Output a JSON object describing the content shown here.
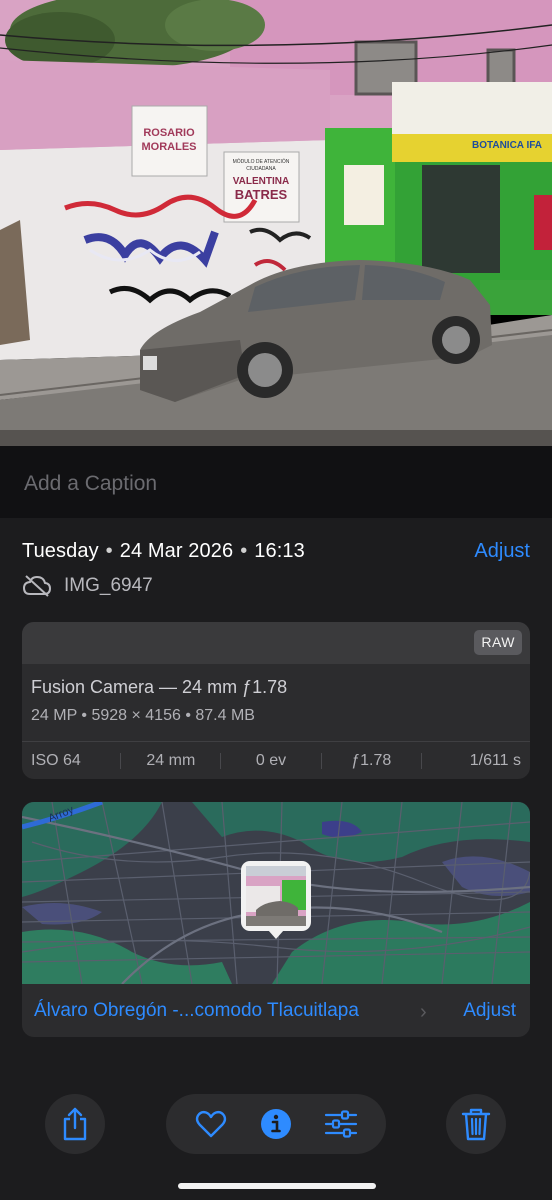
{
  "caption": {
    "placeholder": "Add a Caption"
  },
  "info": {
    "day": "Tuesday",
    "date": "24 Mar 2026",
    "time": "16:13",
    "adjust_label": "Adjust",
    "filename": "IMG_6947",
    "cloud_icon": "cloud-slash-icon"
  },
  "camera": {
    "badge": "RAW",
    "model": "Fusion Camera — 24 mm ƒ1.78",
    "specs": "24 MP  •  5928 × 4156  •  87.4 MB",
    "exif": [
      "ISO 64",
      "24 mm",
      "0 ev",
      "ƒ1.78",
      "1/611 s"
    ]
  },
  "map": {
    "street_label": "Arroy",
    "location": "Álvaro Obregón -...comodo Tlacuitlapa",
    "chevron": "›",
    "adjust_label": "Adjust"
  },
  "photo_signs": {
    "sign1_line1": "ROSARIO",
    "sign1_line2": "MORALES",
    "sign2_line1": "MÓDULO DE ATENCIÓN",
    "sign2_line2": "CIUDADANA",
    "sign2_line3": "VALENTINA",
    "sign2_line4": "BATRES",
    "shop": "BOTANICA   IFA"
  },
  "toolbar": {
    "icons": [
      "share-icon",
      "heart-icon",
      "info-icon",
      "adjust-sliders-icon",
      "trash-icon"
    ]
  },
  "colors": {
    "accent": "#2e8bff",
    "panel": "#1c1c1e",
    "card": "#2c2c2e"
  }
}
